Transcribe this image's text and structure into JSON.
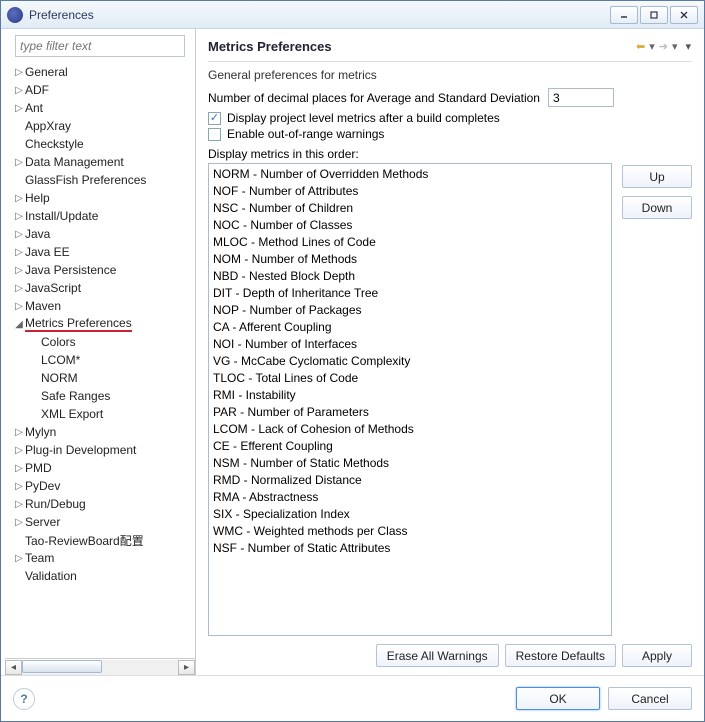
{
  "window": {
    "title": "Preferences"
  },
  "sidebar": {
    "filter_placeholder": "type filter text",
    "items": [
      {
        "label": "General",
        "expandable": true
      },
      {
        "label": "ADF",
        "expandable": true
      },
      {
        "label": "Ant",
        "expandable": true
      },
      {
        "label": "AppXray",
        "expandable": false
      },
      {
        "label": "Checkstyle",
        "expandable": false
      },
      {
        "label": "Data Management",
        "expandable": true
      },
      {
        "label": "GlassFish Preferences",
        "expandable": false
      },
      {
        "label": "Help",
        "expandable": true
      },
      {
        "label": "Install/Update",
        "expandable": true
      },
      {
        "label": "Java",
        "expandable": true
      },
      {
        "label": "Java EE",
        "expandable": true
      },
      {
        "label": "Java Persistence",
        "expandable": true
      },
      {
        "label": "JavaScript",
        "expandable": true
      },
      {
        "label": "Maven",
        "expandable": true
      },
      {
        "label": "Metrics Preferences",
        "expandable": true,
        "selected": true,
        "expanded": true,
        "children": [
          {
            "label": "Colors"
          },
          {
            "label": "LCOM*"
          },
          {
            "label": "NORM"
          },
          {
            "label": "Safe Ranges"
          },
          {
            "label": "XML Export"
          }
        ]
      },
      {
        "label": "Mylyn",
        "expandable": true
      },
      {
        "label": "Plug-in Development",
        "expandable": true
      },
      {
        "label": "PMD",
        "expandable": true
      },
      {
        "label": "PyDev",
        "expandable": true
      },
      {
        "label": "Run/Debug",
        "expandable": true
      },
      {
        "label": "Server",
        "expandable": true
      },
      {
        "label": "Tao-ReviewBoard配置",
        "expandable": false
      },
      {
        "label": "Team",
        "expandable": true
      },
      {
        "label": "Validation",
        "expandable": false
      }
    ]
  },
  "main": {
    "title": "Metrics Preferences",
    "description": "General preferences for metrics",
    "decimal_label": "Number of decimal places for Average and Standard Deviation",
    "decimal_value": "3",
    "checkbox_project": "Display project level metrics after a build completes",
    "checkbox_warnings": "Enable out-of-range warnings",
    "order_label": "Display metrics in this order:",
    "metrics": [
      "NORM - Number of Overridden Methods",
      "NOF - Number of Attributes",
      "NSC - Number of Children",
      "NOC - Number of Classes",
      "MLOC - Method Lines of Code",
      "NOM - Number of Methods",
      "NBD - Nested Block Depth",
      "DIT - Depth of Inheritance Tree",
      "NOP - Number of Packages",
      "CA - Afferent Coupling",
      "NOI - Number of Interfaces",
      "VG - McCabe Cyclomatic Complexity",
      "TLOC - Total Lines of Code",
      "RMI - Instability",
      "PAR - Number of Parameters",
      "LCOM - Lack of Cohesion of Methods",
      "CE - Efferent Coupling",
      "NSM - Number of Static Methods",
      "RMD - Normalized Distance",
      "RMA - Abstractness",
      "SIX - Specialization Index",
      "WMC - Weighted methods per Class",
      "NSF - Number of Static Attributes"
    ],
    "btn_up": "Up",
    "btn_down": "Down",
    "btn_erase": "Erase All Warnings",
    "btn_restore": "Restore Defaults",
    "btn_apply": "Apply"
  },
  "footer": {
    "btn_ok": "OK",
    "btn_cancel": "Cancel"
  }
}
